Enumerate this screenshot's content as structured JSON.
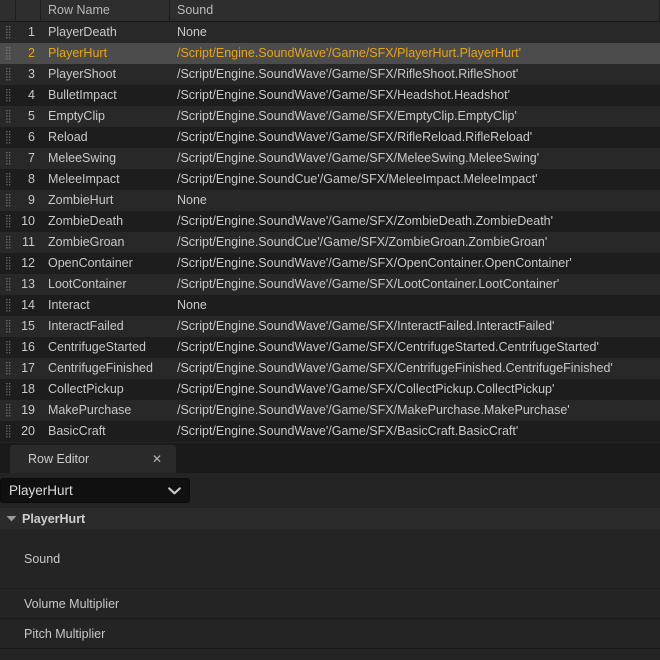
{
  "datatable": {
    "columns": [
      {
        "key": "grip",
        "label": ""
      },
      {
        "key": "index",
        "label": ""
      },
      {
        "key": "name",
        "label": "Row Name"
      },
      {
        "key": "sound",
        "label": "Sound"
      }
    ],
    "rows": [
      {
        "index": "1",
        "name": "PlayerDeath",
        "sound": "None"
      },
      {
        "index": "2",
        "name": "PlayerHurt",
        "sound": "/Script/Engine.SoundWave'/Game/SFX/PlayerHurt.PlayerHurt'"
      },
      {
        "index": "3",
        "name": "PlayerShoot",
        "sound": "/Script/Engine.SoundWave'/Game/SFX/RifleShoot.RifleShoot'"
      },
      {
        "index": "4",
        "name": "BulletImpact",
        "sound": "/Script/Engine.SoundWave'/Game/SFX/Headshot.Headshot'"
      },
      {
        "index": "5",
        "name": "EmptyClip",
        "sound": "/Script/Engine.SoundWave'/Game/SFX/EmptyClip.EmptyClip'"
      },
      {
        "index": "6",
        "name": "Reload",
        "sound": "/Script/Engine.SoundWave'/Game/SFX/RifleReload.RifleReload'"
      },
      {
        "index": "7",
        "name": "MeleeSwing",
        "sound": "/Script/Engine.SoundWave'/Game/SFX/MeleeSwing.MeleeSwing'"
      },
      {
        "index": "8",
        "name": "MeleeImpact",
        "sound": "/Script/Engine.SoundCue'/Game/SFX/MeleeImpact.MeleeImpact'"
      },
      {
        "index": "9",
        "name": "ZombieHurt",
        "sound": "None"
      },
      {
        "index": "10",
        "name": "ZombieDeath",
        "sound": "/Script/Engine.SoundWave'/Game/SFX/ZombieDeath.ZombieDeath'"
      },
      {
        "index": "11",
        "name": "ZombieGroan",
        "sound": "/Script/Engine.SoundCue'/Game/SFX/ZombieGroan.ZombieGroan'"
      },
      {
        "index": "12",
        "name": "OpenContainer",
        "sound": "/Script/Engine.SoundWave'/Game/SFX/OpenContainer.OpenContainer'"
      },
      {
        "index": "13",
        "name": "LootContainer",
        "sound": "/Script/Engine.SoundWave'/Game/SFX/LootContainer.LootContainer'"
      },
      {
        "index": "14",
        "name": "Interact",
        "sound": "None"
      },
      {
        "index": "15",
        "name": "InteractFailed",
        "sound": "/Script/Engine.SoundWave'/Game/SFX/InteractFailed.InteractFailed'"
      },
      {
        "index": "16",
        "name": "CentrifugeStarted",
        "sound": "/Script/Engine.SoundWave'/Game/SFX/CentrifugeStarted.CentrifugeStarted'"
      },
      {
        "index": "17",
        "name": "CentrifugeFinished",
        "sound": "/Script/Engine.SoundWave'/Game/SFX/CentrifugeFinished.CentrifugeFinished'"
      },
      {
        "index": "18",
        "name": "CollectPickup",
        "sound": "/Script/Engine.SoundWave'/Game/SFX/CollectPickup.CollectPickup'"
      },
      {
        "index": "19",
        "name": "MakePurchase",
        "sound": "/Script/Engine.SoundWave'/Game/SFX/MakePurchase.MakePurchase'"
      },
      {
        "index": "20",
        "name": "BasicCraft",
        "sound": "/Script/Engine.SoundWave'/Game/SFX/BasicCraft.BasicCraft'"
      }
    ],
    "selected_index": "2"
  },
  "row_editor": {
    "tab_label": "Row Editor",
    "close_icon": "close-icon",
    "row_selector": {
      "value": "PlayerHurt",
      "arrow_icon": "chevron-down-icon"
    },
    "struct": {
      "expand_icon": "triangle-down-icon",
      "title": "PlayerHurt"
    },
    "properties": [
      {
        "label": "Sound",
        "value": ""
      },
      {
        "label": "Volume Multiplier",
        "value": ""
      },
      {
        "label": "Pitch Multiplier",
        "value": ""
      }
    ]
  },
  "colors": {
    "selection_text": "#e8a317",
    "selection_bg": "#4c4c4c",
    "panel_bg": "#242424",
    "header_bg": "#2e2e2e"
  }
}
